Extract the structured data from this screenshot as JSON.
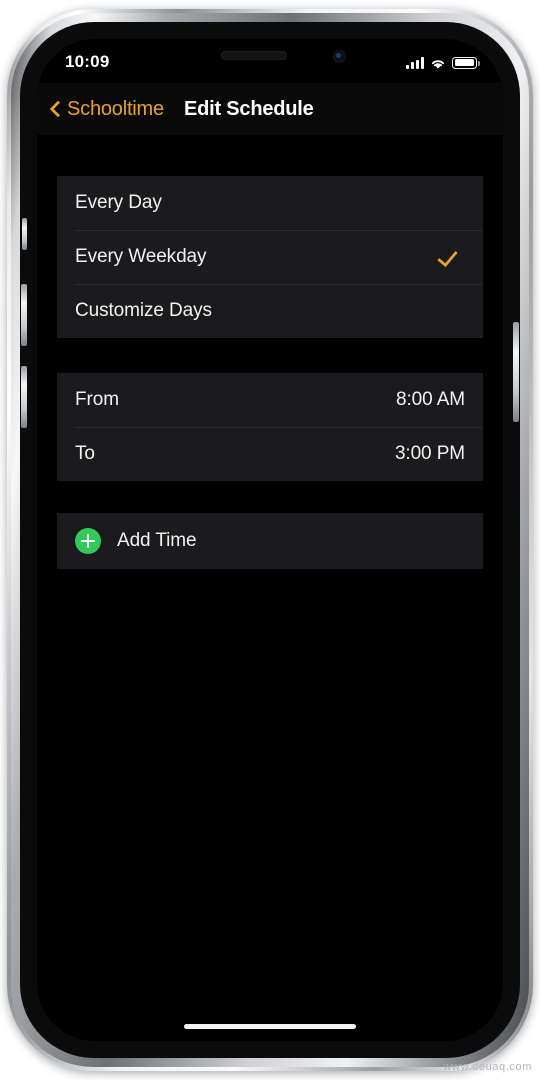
{
  "status_bar": {
    "time": "10:09",
    "signal_icon": "cellular-signal-icon",
    "wifi_icon": "wifi-icon",
    "battery_icon": "battery-full-icon"
  },
  "nav_bar": {
    "back_icon": "chevron-left-icon",
    "back_label": "Schooltime",
    "title": "Edit Schedule"
  },
  "schedule_options": {
    "items": [
      {
        "label": "Every Day",
        "checked": false
      },
      {
        "label": "Every Weekday",
        "checked": true
      },
      {
        "label": "Customize Days",
        "checked": false
      }
    ],
    "check_icon": "checkmark-icon"
  },
  "time_range": {
    "rows": [
      {
        "label": "From",
        "value": "8:00 AM"
      },
      {
        "label": "To",
        "value": "3:00 PM"
      }
    ]
  },
  "add_time": {
    "icon": "plus-circle-icon",
    "label": "Add Time"
  },
  "watermark": {
    "text": "www.deuaq.com"
  },
  "colors": {
    "accent": "#E9A227",
    "green": "#34C759",
    "card_bg": "#1B1B1D",
    "screen_bg": "#000000",
    "text": "#F2F2F2"
  }
}
